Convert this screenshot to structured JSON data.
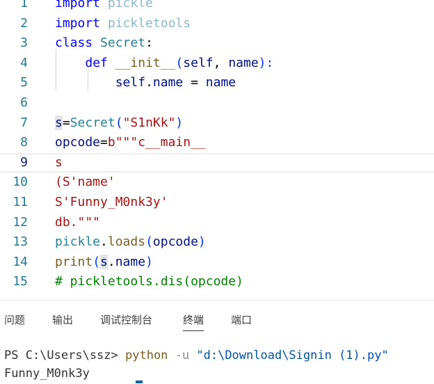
{
  "editor": {
    "lines": [
      {
        "num": "1",
        "tokens": [
          {
            "t": "import",
            "c": "keyword"
          },
          {
            "t": " "
          },
          {
            "t": "pickle",
            "c": "dim"
          }
        ]
      },
      {
        "num": "2",
        "tokens": [
          {
            "t": "import",
            "c": "keyword"
          },
          {
            "t": " "
          },
          {
            "t": "pickletools",
            "c": "dim"
          }
        ]
      },
      {
        "num": "3",
        "tokens": [
          {
            "t": "class",
            "c": "keyword"
          },
          {
            "t": " "
          },
          {
            "t": "Secret",
            "c": "class"
          },
          {
            "t": ":",
            "c": "op"
          }
        ]
      },
      {
        "num": "4",
        "tokens": [
          {
            "t": "    "
          },
          {
            "t": "def",
            "c": "keyword"
          },
          {
            "t": " "
          },
          {
            "t": "__init__",
            "c": "func"
          },
          {
            "t": "(",
            "c": "paren"
          },
          {
            "t": "self",
            "c": "var"
          },
          {
            "t": ", ",
            "c": "op"
          },
          {
            "t": "name",
            "c": "var"
          },
          {
            "t": "):",
            "c": "paren"
          }
        ]
      },
      {
        "num": "5",
        "tokens": [
          {
            "t": "        "
          },
          {
            "t": "self",
            "c": "var"
          },
          {
            "t": ".",
            "c": "op"
          },
          {
            "t": "name",
            "c": "var"
          },
          {
            "t": " = ",
            "c": "op"
          },
          {
            "t": "name",
            "c": "var"
          }
        ]
      },
      {
        "num": "6",
        "tokens": []
      },
      {
        "num": "7",
        "tokens": [
          {
            "t": "s",
            "c": "var",
            "hl": true
          },
          {
            "t": "=",
            "c": "op"
          },
          {
            "t": "Secret",
            "c": "class"
          },
          {
            "t": "(",
            "c": "paren"
          },
          {
            "t": "\"S1nKk\"",
            "c": "string"
          },
          {
            "t": ")",
            "c": "paren"
          }
        ]
      },
      {
        "num": "8",
        "tokens": [
          {
            "t": "opcode",
            "c": "var"
          },
          {
            "t": "=",
            "c": "op"
          },
          {
            "t": "b\"\"\"c__main__",
            "c": "string"
          }
        ]
      },
      {
        "num": "9",
        "tokens": [
          {
            "t": "s",
            "c": "string"
          }
        ],
        "current": true
      },
      {
        "num": "10",
        "tokens": [
          {
            "t": "(S'name'",
            "c": "string"
          }
        ]
      },
      {
        "num": "11",
        "tokens": [
          {
            "t": "S'Funny_M0nk3y'",
            "c": "string"
          }
        ]
      },
      {
        "num": "12",
        "tokens": [
          {
            "t": "db.\"\"\"",
            "c": "string"
          }
        ]
      },
      {
        "num": "13",
        "tokens": [
          {
            "t": "pickle",
            "c": "class"
          },
          {
            "t": ".",
            "c": "op"
          },
          {
            "t": "loads",
            "c": "func"
          },
          {
            "t": "(",
            "c": "paren"
          },
          {
            "t": "opcode",
            "c": "var"
          },
          {
            "t": ")",
            "c": "paren"
          }
        ]
      },
      {
        "num": "14",
        "tokens": [
          {
            "t": "print",
            "c": "func"
          },
          {
            "t": "(",
            "c": "paren"
          },
          {
            "t": "s",
            "c": "var",
            "hl": true
          },
          {
            "t": ".",
            "c": "op"
          },
          {
            "t": "name",
            "c": "var"
          },
          {
            "t": ")",
            "c": "paren"
          }
        ]
      },
      {
        "num": "15",
        "tokens": [
          {
            "t": "# pickletools.dis(opcode)",
            "c": "comment"
          }
        ]
      }
    ]
  },
  "panel": {
    "tabs": [
      {
        "label": "问题"
      },
      {
        "label": "输出"
      },
      {
        "label": "调试控制台"
      },
      {
        "label": "终端",
        "active": true
      },
      {
        "label": "端口"
      }
    ]
  },
  "terminal": {
    "prompt": "PS C:\\Users\\ssz> ",
    "command": "python",
    "arg": " -u ",
    "path": "\"d:\\Download\\Signin (1).py\"",
    "output": "Funny_M0nk3y"
  }
}
